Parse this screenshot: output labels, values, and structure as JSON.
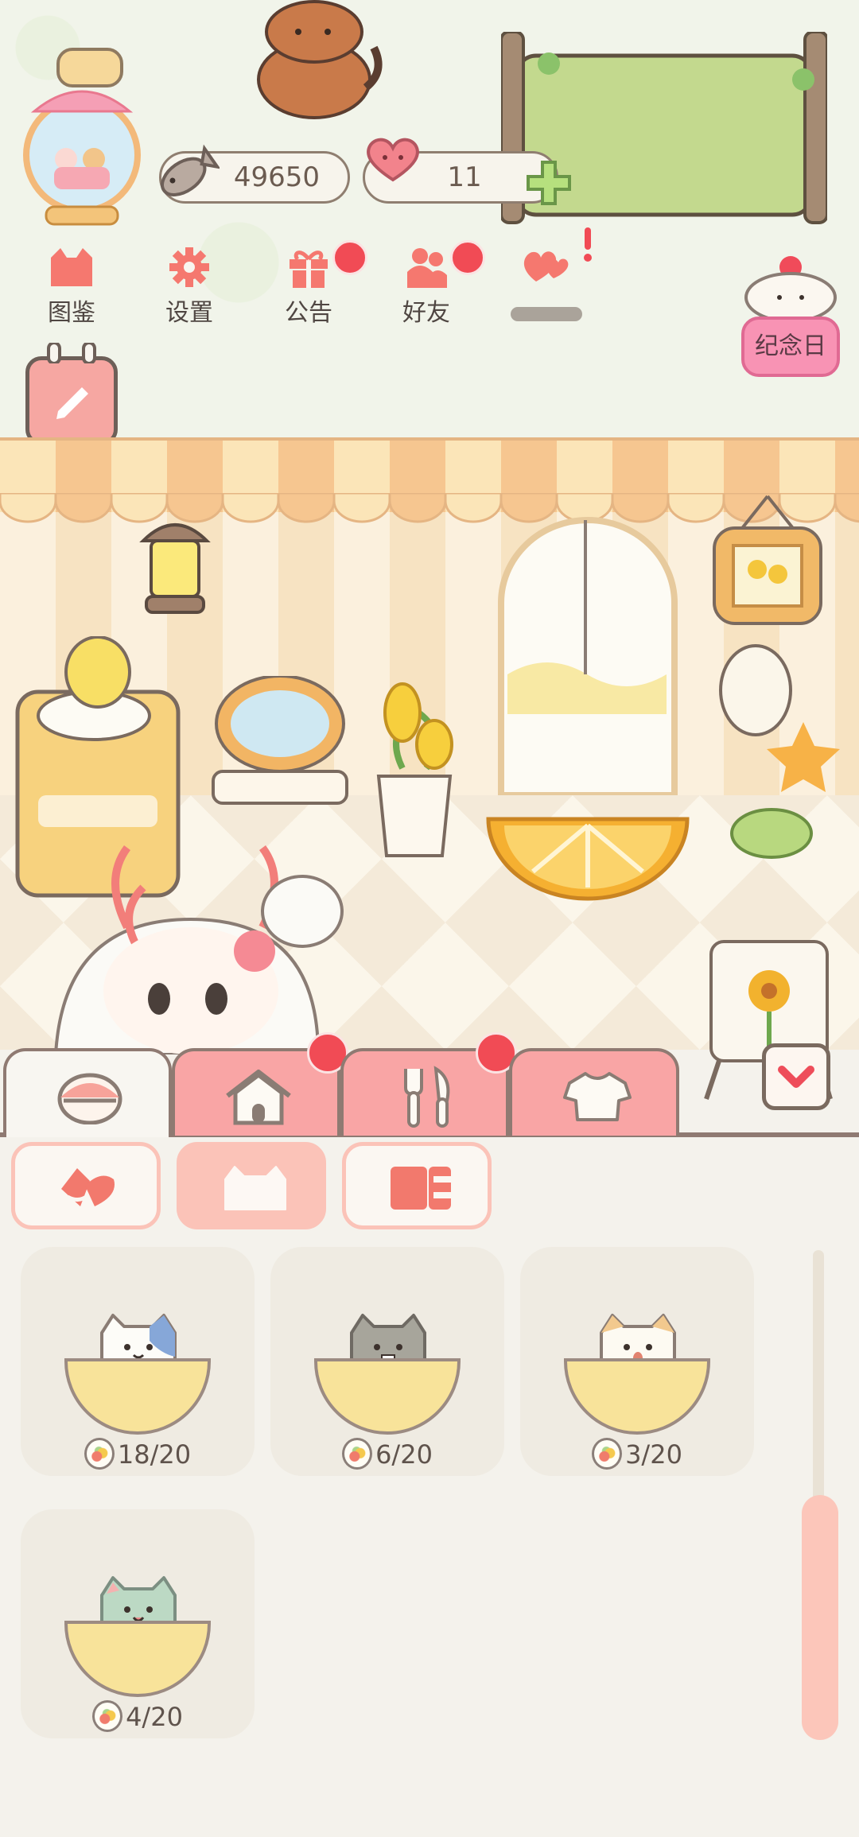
{
  "currencies": {
    "fish_value": "49650",
    "hearts_value": "11"
  },
  "top_menu": [
    {
      "label": "图鉴",
      "icon": "cat-face-icon"
    },
    {
      "label": "设置",
      "icon": "gear-icon"
    },
    {
      "label": "公告",
      "icon": "gift-icon"
    },
    {
      "label": "好友",
      "icon": "friends-icon"
    },
    {
      "label": "",
      "icon": "hearts-icon"
    }
  ],
  "anniversary_label": "纪念日",
  "main_tabs": [
    {
      "icon": "character-face-icon",
      "active": true
    },
    {
      "icon": "house-icon",
      "active": false
    },
    {
      "icon": "fork-knife-icon",
      "active": false
    },
    {
      "icon": "shirt-icon",
      "active": false
    }
  ],
  "sub_tabs": [
    {
      "icon": "hearts-icon",
      "active": false
    },
    {
      "icon": "cat-face-icon",
      "active": true
    },
    {
      "icon": "book-icon",
      "active": false
    }
  ],
  "cat_cards": [
    {
      "count": "18/20",
      "cat": "calico-cat"
    },
    {
      "count": "6/20",
      "cat": "gray-cat"
    },
    {
      "count": "3/20",
      "cat": "cream-cat"
    },
    {
      "count": "4/20",
      "cat": "mint-cat"
    }
  ],
  "colors": {
    "accent_pink": "#f9a5a5",
    "badge_red": "#f14b55",
    "bowl_yellow": "#f8e39a",
    "outline": "#8f7a72"
  }
}
